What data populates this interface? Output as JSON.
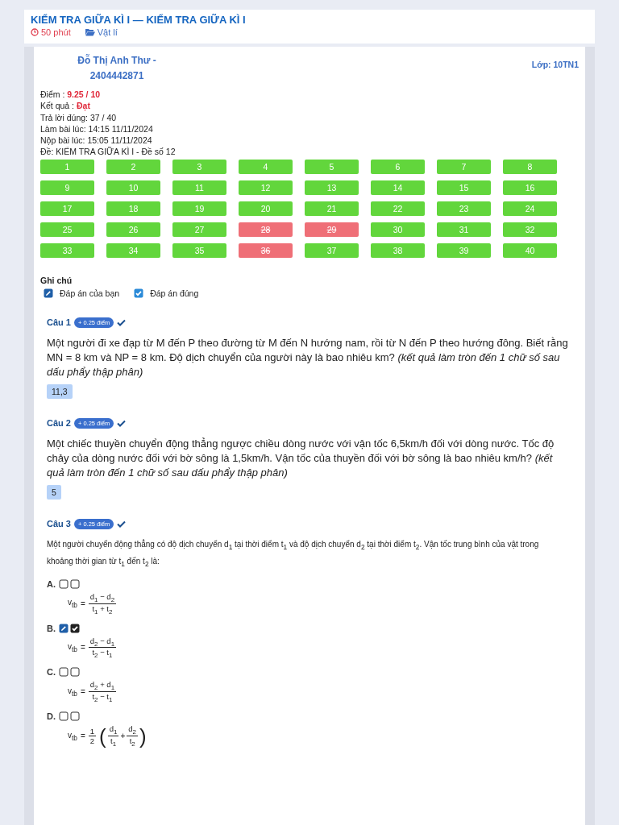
{
  "exam": {
    "title": "KIỂM TRA GIỮA KÌ I — KIỂM TRA GIỮA KÌ I",
    "duration": "50 phút",
    "subject": "Vật lí"
  },
  "student": {
    "name": "Đỗ Thị Anh Thư -",
    "id": "2404442871",
    "class": "Lớp: 10TN1"
  },
  "summary": [
    {
      "label": "Điểm :",
      "value": "9.25 / 10",
      "highlight": true
    },
    {
      "label": "Kết quả :",
      "value": "Đạt",
      "highlight": true
    },
    {
      "label": "Trả lời đúng:",
      "value": "37 / 40",
      "highlight": false
    },
    {
      "label": "Làm bài lúc:",
      "value": "14:15 11/11/2024",
      "highlight": false
    },
    {
      "label": "Nộp bài lúc:",
      "value": "15:05 11/11/2024",
      "highlight": false
    },
    {
      "label": "Đề:",
      "value": "KIỂM TRA GIỮA KÌ I - Đề số 12",
      "highlight": false
    }
  ],
  "answer_grid": [
    {
      "number": "1",
      "correct": true
    },
    {
      "number": "2",
      "correct": true
    },
    {
      "number": "3",
      "correct": true
    },
    {
      "number": "4",
      "correct": true
    },
    {
      "number": "5",
      "correct": true
    },
    {
      "number": "6",
      "correct": true
    },
    {
      "number": "7",
      "correct": true
    },
    {
      "number": "8",
      "correct": true
    },
    {
      "number": "9",
      "correct": true
    },
    {
      "number": "10",
      "correct": true
    },
    {
      "number": "11",
      "correct": true
    },
    {
      "number": "12",
      "correct": true
    },
    {
      "number": "13",
      "correct": true
    },
    {
      "number": "14",
      "correct": true
    },
    {
      "number": "15",
      "correct": true
    },
    {
      "number": "16",
      "correct": true
    },
    {
      "number": "17",
      "correct": true
    },
    {
      "number": "18",
      "correct": true
    },
    {
      "number": "19",
      "correct": true
    },
    {
      "number": "20",
      "correct": true
    },
    {
      "number": "21",
      "correct": true
    },
    {
      "number": "22",
      "correct": true
    },
    {
      "number": "23",
      "correct": true
    },
    {
      "number": "24",
      "correct": true
    },
    {
      "number": "25",
      "correct": true
    },
    {
      "number": "26",
      "correct": true
    },
    {
      "number": "27",
      "correct": true
    },
    {
      "number": "28",
      "correct": false
    },
    {
      "number": "29",
      "correct": false
    },
    {
      "number": "30",
      "correct": true
    },
    {
      "number": "31",
      "correct": true
    },
    {
      "number": "32",
      "correct": true
    },
    {
      "number": "33",
      "correct": true
    },
    {
      "number": "34",
      "correct": true
    },
    {
      "number": "35",
      "correct": true
    },
    {
      "number": "36",
      "correct": false
    },
    {
      "number": "37",
      "correct": true
    },
    {
      "number": "38",
      "correct": true
    },
    {
      "number": "39",
      "correct": true
    },
    {
      "number": "40",
      "correct": true
    }
  ],
  "legend": {
    "title": "Ghi chú",
    "items": [
      {
        "kind": "yours",
        "label": "Đáp án của bạn"
      },
      {
        "kind": "correct",
        "label": "Đáp án đúng"
      }
    ]
  },
  "questions": [
    {
      "kind": "short_answer",
      "label": "Câu 1",
      "points": "+ 0.25 điểm",
      "correct": true,
      "text": "Một người đi xe đạp từ M đến P theo đường từ M đến N hướng nam, rồi từ N đến P theo hướng đông. Biết rằng MN = 8 km và NP = 8 km. Độ dịch chuyển của người này là bao nhiêu km? *(kết quả làm tròn đến 1 chữ số sau dấu phẩy thập phân)*",
      "answer": "11,3"
    },
    {
      "kind": "short_answer",
      "label": "Câu 2",
      "points": "+ 0.25 điểm",
      "correct": true,
      "text": "Một chiếc thuyền chuyển động thẳng ngược chiều dòng nước với vận tốc 6,5km/h đối với dòng nước. Tốc độ chảy của dòng nước đối với bờ sông là 1,5km/h. Vận tốc của thuyền đối với bờ sông là bao nhiêu km/h? *(kết quả làm tròn đến 1 chữ số sau dấu phẩy thập phân)*",
      "answer": "5"
    },
    {
      "kind": "multiple_choice",
      "label": "Câu 3",
      "points": "+ 0.25 điểm",
      "correct": true,
      "text": "Một người chuyển động thẳng có độ dịch chuyển d$_{1}$ tại thời điểm t$_{1}$ và độ dịch chuyển d$_{2}$ tại thời điểm t$_{2}$. Vận tốc trung bình của vật trong khoảng thời gian từ t$_{1}$ đến t$_{2}$ là:",
      "options": [
        {
          "letter": "A.",
          "yours": false,
          "correct": false,
          "formula": {
            "kind": "fraction",
            "lhs": "v$_{tb}$",
            "relation": "=",
            "numerator": "d$_{1}$ − d$_{2}$",
            "denominator": "t$_{1}$ + t$_{2}$"
          }
        },
        {
          "letter": "B.",
          "yours": true,
          "correct": true,
          "formula": {
            "kind": "fraction",
            "lhs": "v$_{tb}$",
            "relation": "=",
            "numerator": "d$_{2}$ − d$_{1}$",
            "denominator": "t$_{2}$ − t$_{1}$"
          }
        },
        {
          "letter": "C.",
          "yours": false,
          "correct": false,
          "formula": {
            "kind": "fraction",
            "lhs": "v$_{tb}$",
            "relation": "=",
            "numerator": "d$_{2}$ + d$_{1}$",
            "denominator": "t$_{2}$ − t$_{1}$"
          }
        },
        {
          "letter": "D.",
          "yours": false,
          "correct": false,
          "formula": {
            "kind": "scaled_sum",
            "lhs": "v$_{tb}$",
            "relation": "=",
            "coefficient": {
              "numerator": "1",
              "denominator": "2"
            },
            "open": "(",
            "close": ")",
            "operator": "+",
            "terms": [
              {
                "numerator": "d$_{1}$",
                "denominator": "t$_{1}$"
              },
              {
                "numerator": "d$_{2}$",
                "denominator": "t$_{2}$"
              }
            ]
          }
        }
      ]
    }
  ]
}
